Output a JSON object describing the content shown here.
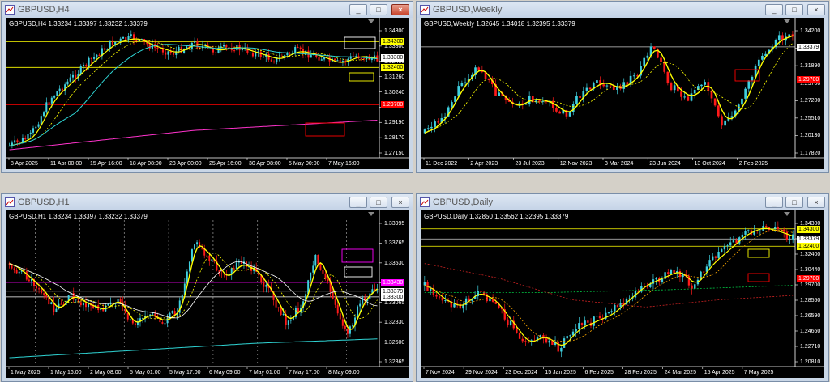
{
  "windows": [
    {
      "id": "h4",
      "title": "GBPUSD,H4",
      "info": "GBPUSD,H4  1.33234 1.33397 1.33232 1.33379",
      "active": true,
      "price_scale": [
        "1.34300",
        "1.33300",
        "1.32400",
        "1.31260",
        "1.30240",
        "1.29700",
        "1.29190",
        "1.28170",
        "1.27150"
      ],
      "time_labels": [
        "8 Apr 2025",
        "11 Apr 00:00",
        "15 Apr 16:00",
        "18 Apr 08:00",
        "23 Apr 00:00",
        "25 Apr 16:00",
        "30 Apr 08:00",
        "5 May 00:00",
        "7 May 16:00"
      ],
      "highlight_labels": [
        {
          "text": "1.34300",
          "bg": "#ffff00",
          "fg": "#000000"
        },
        {
          "text": "1.33300",
          "bg": "#ffffff",
          "fg": "#000000"
        },
        {
          "text": "1.32400",
          "bg": "#ffff00",
          "fg": "#000000"
        },
        {
          "text": "1.29700",
          "bg": "#ff0000",
          "fg": "#ffffff"
        }
      ]
    },
    {
      "id": "weekly",
      "title": "GBPUSD,Weekly",
      "info": "GBPUSD,Weekly  1.32645 1.34018 1.32395 1.33379",
      "active": false,
      "price_scale": [
        "1.34200",
        "1.33379",
        "1.31890",
        "1.29700",
        "1.27200",
        "1.25510",
        "1.20130",
        "1.17820"
      ],
      "time_labels": [
        "11 Dec 2022",
        "2 Apr 2023",
        "23 Jul 2023",
        "12 Nov 2023",
        "3 Mar 2024",
        "23 Jun 2024",
        "13 Oct 2024",
        "2 Feb 2025"
      ],
      "highlight_labels": [
        {
          "text": "1.33379",
          "bg": "#ffffff",
          "fg": "#000000"
        },
        {
          "text": "1.29700",
          "bg": "#ff0000",
          "fg": "#ffffff"
        }
      ]
    },
    {
      "id": "h1",
      "title": "GBPUSD,H1",
      "info": "GBPUSD,H1  1.33234 1.33397 1.33232 1.33379",
      "active": false,
      "price_scale": [
        "1.33995",
        "1.33765",
        "1.33530",
        "1.33300",
        "1.33065",
        "1.32830",
        "1.32600",
        "1.32365"
      ],
      "time_labels": [
        "1 May 2025",
        "1 May 16:00",
        "2 May 08:00",
        "5 May 01:00",
        "5 May 17:00",
        "6 May 09:00",
        "7 May 01:00",
        "7 May 17:00",
        "8 May 09:00"
      ],
      "highlight_labels": [
        {
          "text": "1.33430",
          "bg": "#ff00ff",
          "fg": "#ffffff"
        },
        {
          "text": "1.33379",
          "bg": "#ffffff",
          "fg": "#000000"
        },
        {
          "text": "1.33300",
          "bg": "#ffffff",
          "fg": "#000000"
        }
      ]
    },
    {
      "id": "daily",
      "title": "GBPUSD,Daily",
      "info": "GBPUSD,Daily  1.32850 1.33562 1.32395 1.33379",
      "active": false,
      "price_scale": [
        "1.34300",
        "1.33379",
        "1.32400",
        "1.30440",
        "1.29700",
        "1.28550",
        "1.26590",
        "1.24660",
        "1.22710",
        "1.20810"
      ],
      "time_labels": [
        "7 Nov 2024",
        "29 Nov 2024",
        "23 Dec 2024",
        "15 Jan 2025",
        "6 Feb 2025",
        "28 Feb 2025",
        "24 Mar 2025",
        "15 Apr 2025",
        "7 May 2025"
      ],
      "highlight_labels": [
        {
          "text": "1.34300",
          "bg": "#ffff00",
          "fg": "#000000"
        },
        {
          "text": "1.33379",
          "bg": "#ffffff",
          "fg": "#000000"
        },
        {
          "text": "1.32400",
          "bg": "#ffff00",
          "fg": "#000000"
        },
        {
          "text": "1.29700",
          "bg": "#ff0000",
          "fg": "#ffffff"
        }
      ]
    }
  ],
  "buttons": {
    "minimize": "_",
    "maximize": "□",
    "close": "×"
  },
  "colors": {
    "bull": "#3fd0e0",
    "bear": "#ff1a1a",
    "ma_yellow": "#ffff00",
    "ma_cyan": "#2fd4d4",
    "ma_magenta": "#ff33cc",
    "level_yellow": "#ffff00",
    "level_red": "#ff0000"
  }
}
